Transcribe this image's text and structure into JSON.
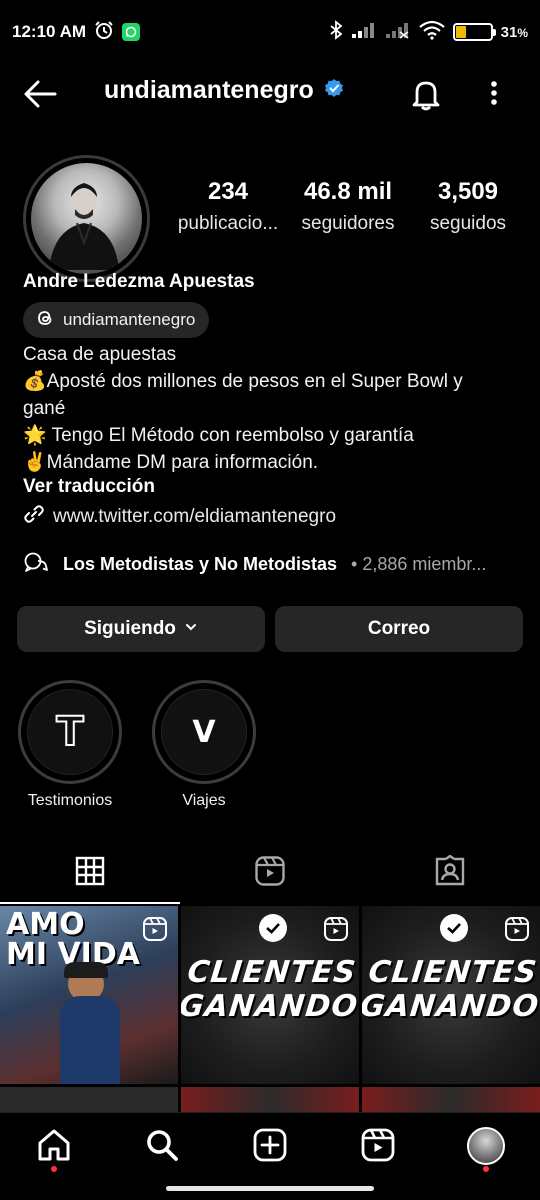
{
  "status_bar": {
    "time": "12:10 AM",
    "battery_text": "31",
    "battery_percent_sign": "%",
    "battery_level": 0.31,
    "icons": [
      "alarm-icon",
      "whatsapp-icon",
      "bluetooth-icon",
      "cell-signal-icon",
      "cell-signal-off-icon",
      "wifi-icon",
      "battery-icon"
    ]
  },
  "header": {
    "username": "undiamantenegro",
    "verified": true,
    "accent_color": "#3897f0"
  },
  "stats": {
    "posts": {
      "value": "234",
      "label": "publicacio..."
    },
    "followers": {
      "value": "46.8 mil",
      "label": "seguidores"
    },
    "following": {
      "value": "3,509",
      "label": "seguidos"
    }
  },
  "profile": {
    "display_name": "Andre Ledezma Apuestas",
    "threads_handle": "undiamantenegro",
    "bio_lines": [
      "Casa de apuestas",
      "💰Aposté dos millones de pesos en el Super Bowl y",
      "gané",
      "🌟 Tengo El Método con reembolso y garantía",
      "✌️Mándame DM para información."
    ],
    "translate_label": "Ver traducción",
    "link": "www.twitter.com/eldiamantenegro"
  },
  "channel": {
    "name": "Los Metodistas y No Metodistas",
    "separator": "•",
    "members": "2,886 miembr..."
  },
  "buttons": {
    "following_label": "Siguiendo",
    "email_label": "Correo"
  },
  "highlights": [
    {
      "letter": "T",
      "label": "Testimonios"
    },
    {
      "letter": "V",
      "label": "Viajes"
    }
  ],
  "tabs": [
    "grid-icon",
    "reels-icon",
    "tagged-icon"
  ],
  "posts": {
    "photo_title_line1": "AMO",
    "photo_title_line2": "MI VIDA",
    "promo_line1": "CLIENTES",
    "promo_line2": "GANANDO"
  },
  "bottom_nav": [
    "home-icon",
    "search-icon",
    "create-icon",
    "reels-icon",
    "profile-avatar"
  ],
  "colors": {
    "background": "#000000",
    "button_bg": "#262626",
    "notification_dot": "#ff3040",
    "battery_fill": "#f2b705",
    "whatsapp": "#25d366"
  }
}
